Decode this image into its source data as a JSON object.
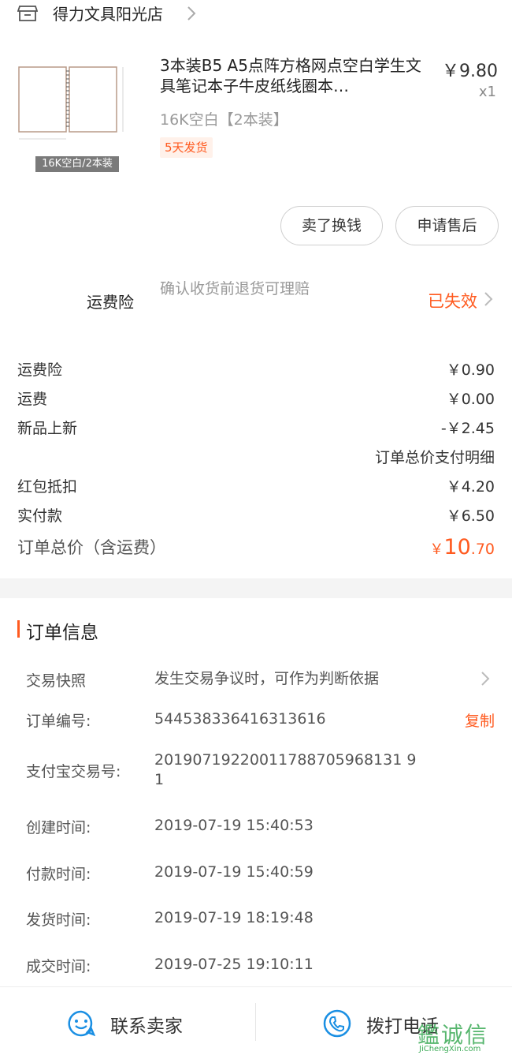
{
  "shop": {
    "name": "得力文具阳光店"
  },
  "product": {
    "title": "3本装B5 A5点阵方格网点空白学生文具笔记本子牛皮纸线圈本…",
    "price": "￥9.80",
    "qty": "x1",
    "spec": "16K空白【2本装】",
    "ship_tag": "5天发货",
    "thumb_badge": "16K空白/2本装"
  },
  "actions": {
    "sell": "卖了换钱",
    "after_sales": "申请售后"
  },
  "insurance": {
    "label": "运费险",
    "desc": "确认收货前退货可理赔",
    "status": "已失效"
  },
  "price_rows": [
    {
      "label": "运费险",
      "value": "￥0.90"
    },
    {
      "label": "运费",
      "value": "￥0.00"
    },
    {
      "label": "新品上新",
      "value": "-￥2.45"
    }
  ],
  "detail_link": "订单总价支付明细",
  "pay_rows": [
    {
      "label": "红包抵扣",
      "value": "￥4.20"
    },
    {
      "label": "实付款",
      "value": "￥6.50"
    }
  ],
  "total": {
    "label": "订单总价（含运费）",
    "yen": "￥",
    "int": "10",
    "dec": ".70"
  },
  "order_info": {
    "title": "订单信息",
    "snapshot_label": "交易快照",
    "snapshot_value": "发生交易争议时，可作为判断依据",
    "order_no_label": "订单编号:",
    "order_no": "544538336416313616",
    "copy": "复制",
    "alipay_label": "支付宝交易号:",
    "alipay_no": "20190719220011788705968131 9 1",
    "created_label": "创建时间:",
    "created": "2019-07-19 15:40:53",
    "paid_label": "付款时间:",
    "paid": "2019-07-19 15:40:59",
    "shipped_label": "发货时间:",
    "shipped": "2019-07-19 18:19:48",
    "done_label": "成交时间:",
    "done": "2019-07-25 19:10:11"
  },
  "bottom": {
    "contact": "联系卖家",
    "call": "拨打电话"
  },
  "watermark": {
    "text": "鑑诚信",
    "sub": "JiChengXin.com"
  },
  "colors": {
    "accent": "#ff5a1f",
    "call_icon": "#1a8fe3"
  }
}
